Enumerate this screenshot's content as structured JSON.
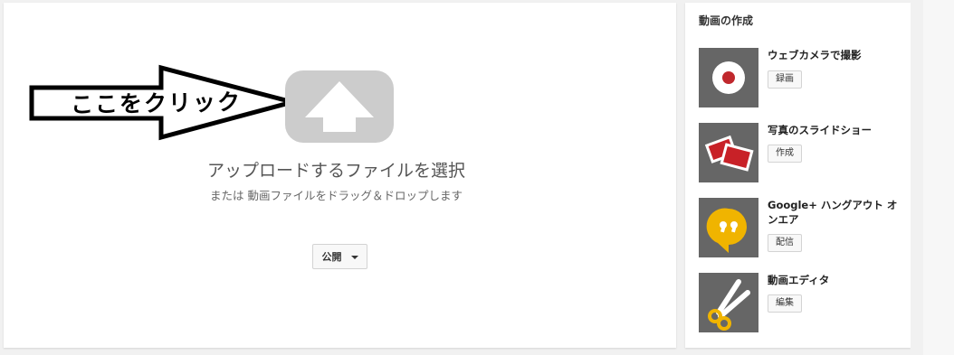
{
  "upload": {
    "annotation_text": "ここをクリック",
    "title": "アップロードするファイルを選択",
    "subtitle": "または 動画ファイルをドラッグ＆ドロップします",
    "privacy_label": "公開"
  },
  "sidebar": {
    "title": "動画の作成",
    "items": [
      {
        "label": "ウェブカメラで撮影",
        "button": "録画",
        "icon": "record-icon"
      },
      {
        "label": "写真のスライドショー",
        "button": "作成",
        "icon": "photos-icon"
      },
      {
        "label": "Google+ ハングアウト オンエア",
        "button": "配信",
        "icon": "hangouts-icon"
      },
      {
        "label": "動画エディタ",
        "button": "編集",
        "icon": "scissors-icon"
      }
    ]
  },
  "colors": {
    "record_dot": "#c0282d",
    "hangouts_yellow": "#f0b400",
    "photo_red": "#c82127",
    "scissors_yellow": "#f0b400"
  }
}
